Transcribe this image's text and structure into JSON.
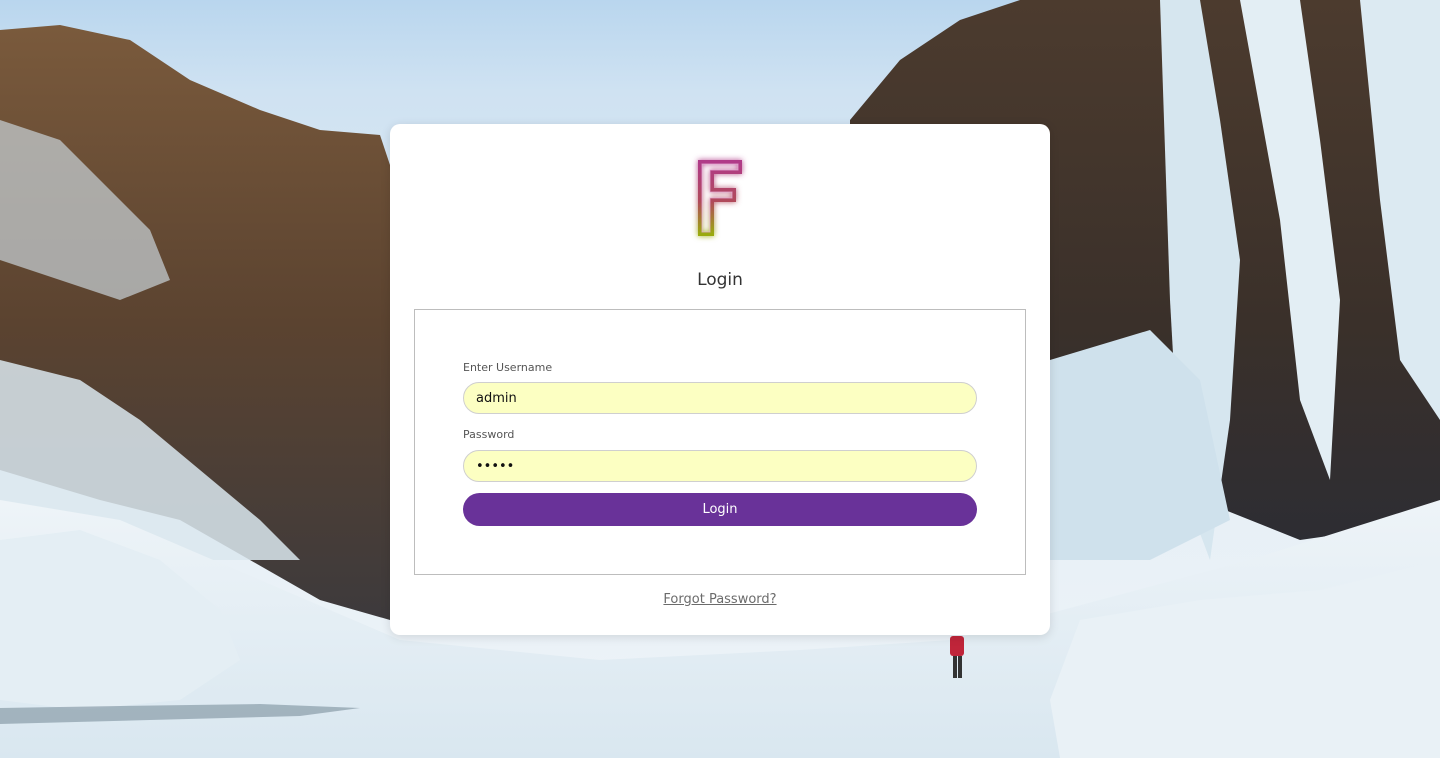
{
  "login": {
    "title": "Login",
    "username_label": "Enter Username",
    "username_value": "admin",
    "password_label": "Password",
    "password_value": "admin",
    "submit_label": "Login",
    "forgot_link": "Forgot Password?"
  },
  "logo": {
    "letter": "F"
  },
  "colors": {
    "accent": "#693299",
    "input_bg": "#fcffc2",
    "card_bg": "#ffffff"
  }
}
